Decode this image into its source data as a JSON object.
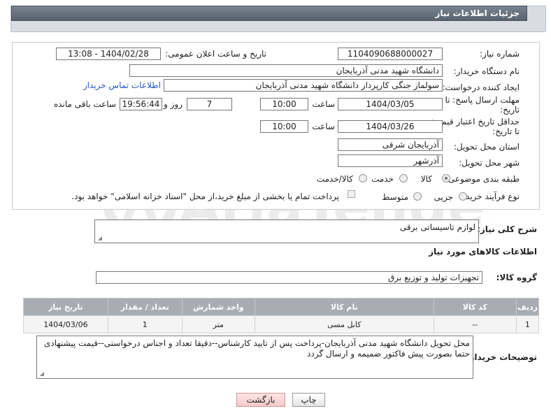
{
  "header": {
    "title": "جزئیات اطلاعات نیاز"
  },
  "form": {
    "need_number": {
      "label": "شماره نیاز:",
      "value": "1104090688000027"
    },
    "announce_datetime": {
      "label": "تاریخ و ساعت اعلان عمومی:",
      "value": "1404/02/28 - 13:08"
    },
    "buyer_org": {
      "label": "نام دستگاه خریدار:",
      "value": "دانشگاه شهید مدنی آذربایجان"
    },
    "requester": {
      "label": "ایجاد کننده درخواست:",
      "value": "سولماز جنگی کارپرداز دانشگاه شهید مدنی آذربایجان",
      "contact_link": "اطلاعات تماس خریدار"
    },
    "reply_deadline": {
      "label_line1": "مهلت ارسال پاسخ: تا",
      "label_line2": "تاریخ:",
      "date": "1404/03/05",
      "time_label": "ساعت",
      "time": "10:00",
      "days": "7",
      "days_label": "روز و",
      "remaining": "19:56:44",
      "remaining_label": "ساعت باقی مانده"
    },
    "price_validity": {
      "label_line1": "حداقل تاریخ اعتبار قیمت:",
      "label_line2": "تا تاریخ:",
      "date": "1404/03/26",
      "time_label": "ساعت",
      "time": "10:00"
    },
    "province": {
      "label": "استان محل تحویل:",
      "value": "آذربایجان شرقی"
    },
    "city": {
      "label": "شهر محل تحویل:",
      "value": "آذرشهر"
    },
    "category": {
      "label": "طبقه بندی موضوعی:",
      "options": [
        "کالا",
        "خدمت",
        "کالا/خدمت"
      ],
      "selected": "کالا"
    },
    "purchase_process": {
      "label": "نوع فرآیند خرید :",
      "options": [
        "جزیی",
        "متوسط"
      ],
      "payment_note": "پرداخت تمام یا بخشی از مبلغ خرید،از محل \"اسناد خزانه اسلامی\" خواهد بود."
    }
  },
  "summary": {
    "label": "شرح کلی نیاز:",
    "value": "لوازم تاسیساتی برقی"
  },
  "goods_section": {
    "title": "اطلاعات کالاهای مورد نیاز"
  },
  "goods_group": {
    "label": "گروه کالا:",
    "value": "تجهیزات تولید و توزیع برق"
  },
  "table": {
    "headers": [
      "ردیف",
      "کد کالا",
      "نام کالا",
      "واحد شمارش",
      "تعداد / مقدار",
      "تاریخ نیاز"
    ],
    "rows": [
      [
        "1",
        "--",
        "کابل مسی",
        "متر",
        "1",
        "1404/03/06"
      ]
    ]
  },
  "buyer_notes": {
    "label": "توضیحات خریدار:",
    "value": "محل تحویل دانشگاه شهید مدنی آذربایجان-پرداخت پس از تایید کارشناس--دقیقا تعداد و اجناس درخواستی--قیمت پیشنهادی حتما بصورت پیش فاکتور ضمیمه و ارسال گردد"
  },
  "buttons": {
    "print": "چاپ",
    "back": "بازگشت"
  },
  "watermark": {
    "text": "AriaTender.neT"
  },
  "colors": {
    "title_bar": "#646e7a",
    "link": "#2a55c7",
    "table_header": "#a9adb3",
    "back_button": "#f9d6d6"
  }
}
